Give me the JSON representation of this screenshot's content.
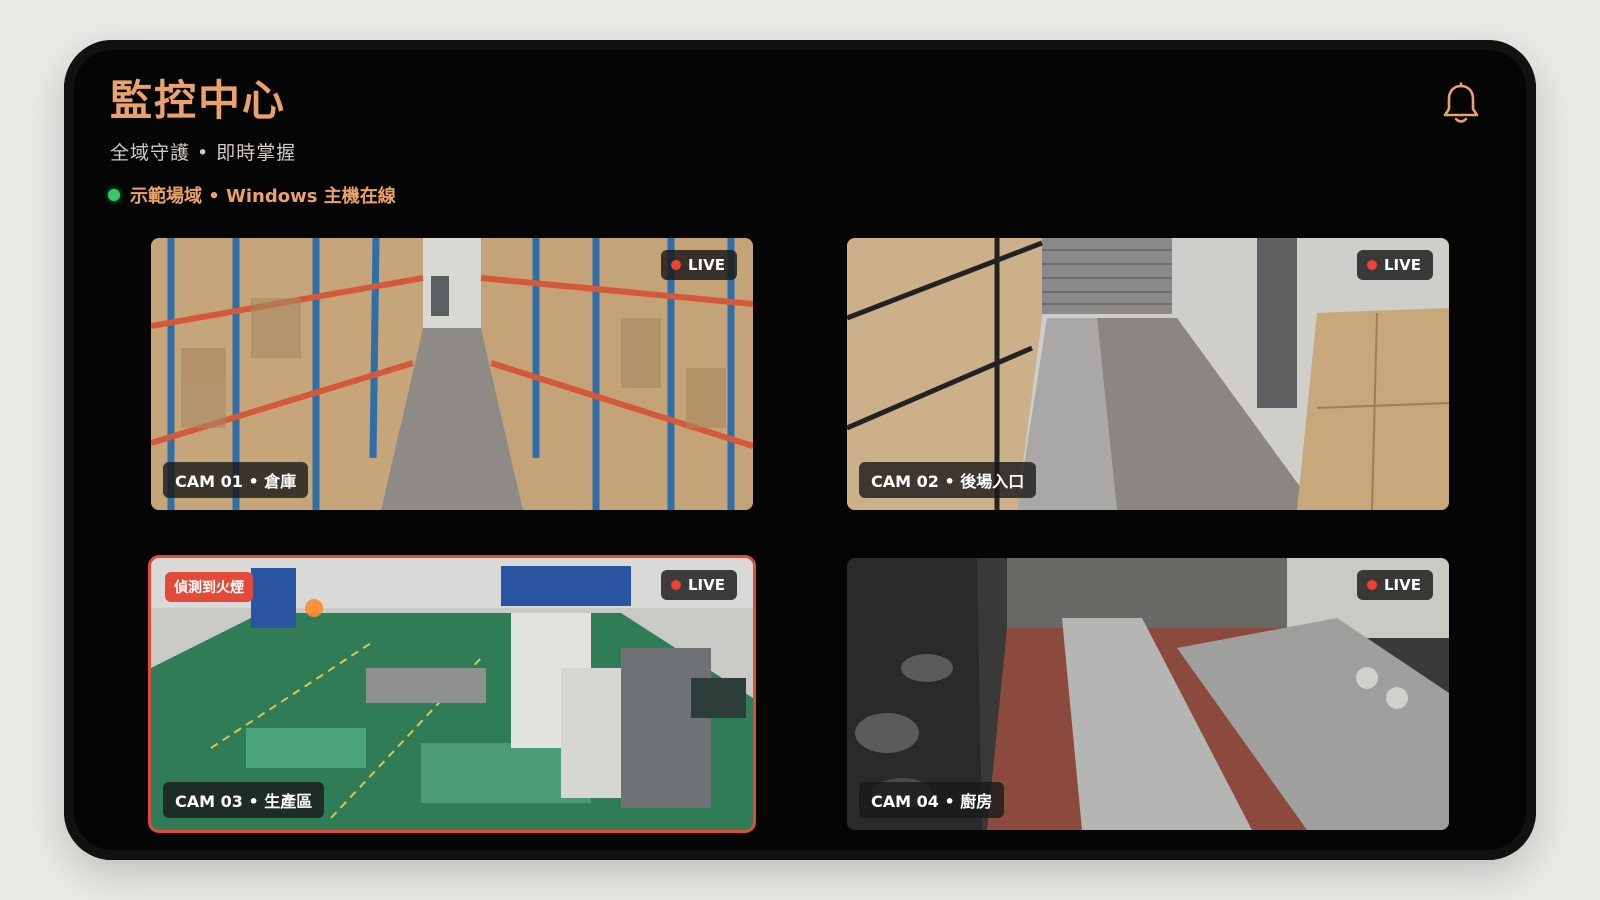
{
  "header": {
    "title": "監控中心",
    "subtitle": "全域守護 • 即時掌握",
    "status": "示範場域 • Windows 主機在線",
    "status_color": "#36c86b",
    "accent_color": "#eba16b",
    "notification_icon": "bell-icon"
  },
  "cameras": [
    {
      "label": "CAM 01 • 倉庫",
      "live": "LIVE",
      "scene": "warehouse"
    },
    {
      "label": "CAM 02 • 後場入口",
      "live": "LIVE",
      "scene": "back-entrance"
    },
    {
      "label": "CAM 03 • 生產區",
      "live": "LIVE",
      "scene": "production",
      "alert": "偵測到火煙",
      "alert_color": "#e24a3a"
    },
    {
      "label": "CAM 04 • 廚房",
      "live": "LIVE",
      "scene": "kitchen"
    }
  ]
}
